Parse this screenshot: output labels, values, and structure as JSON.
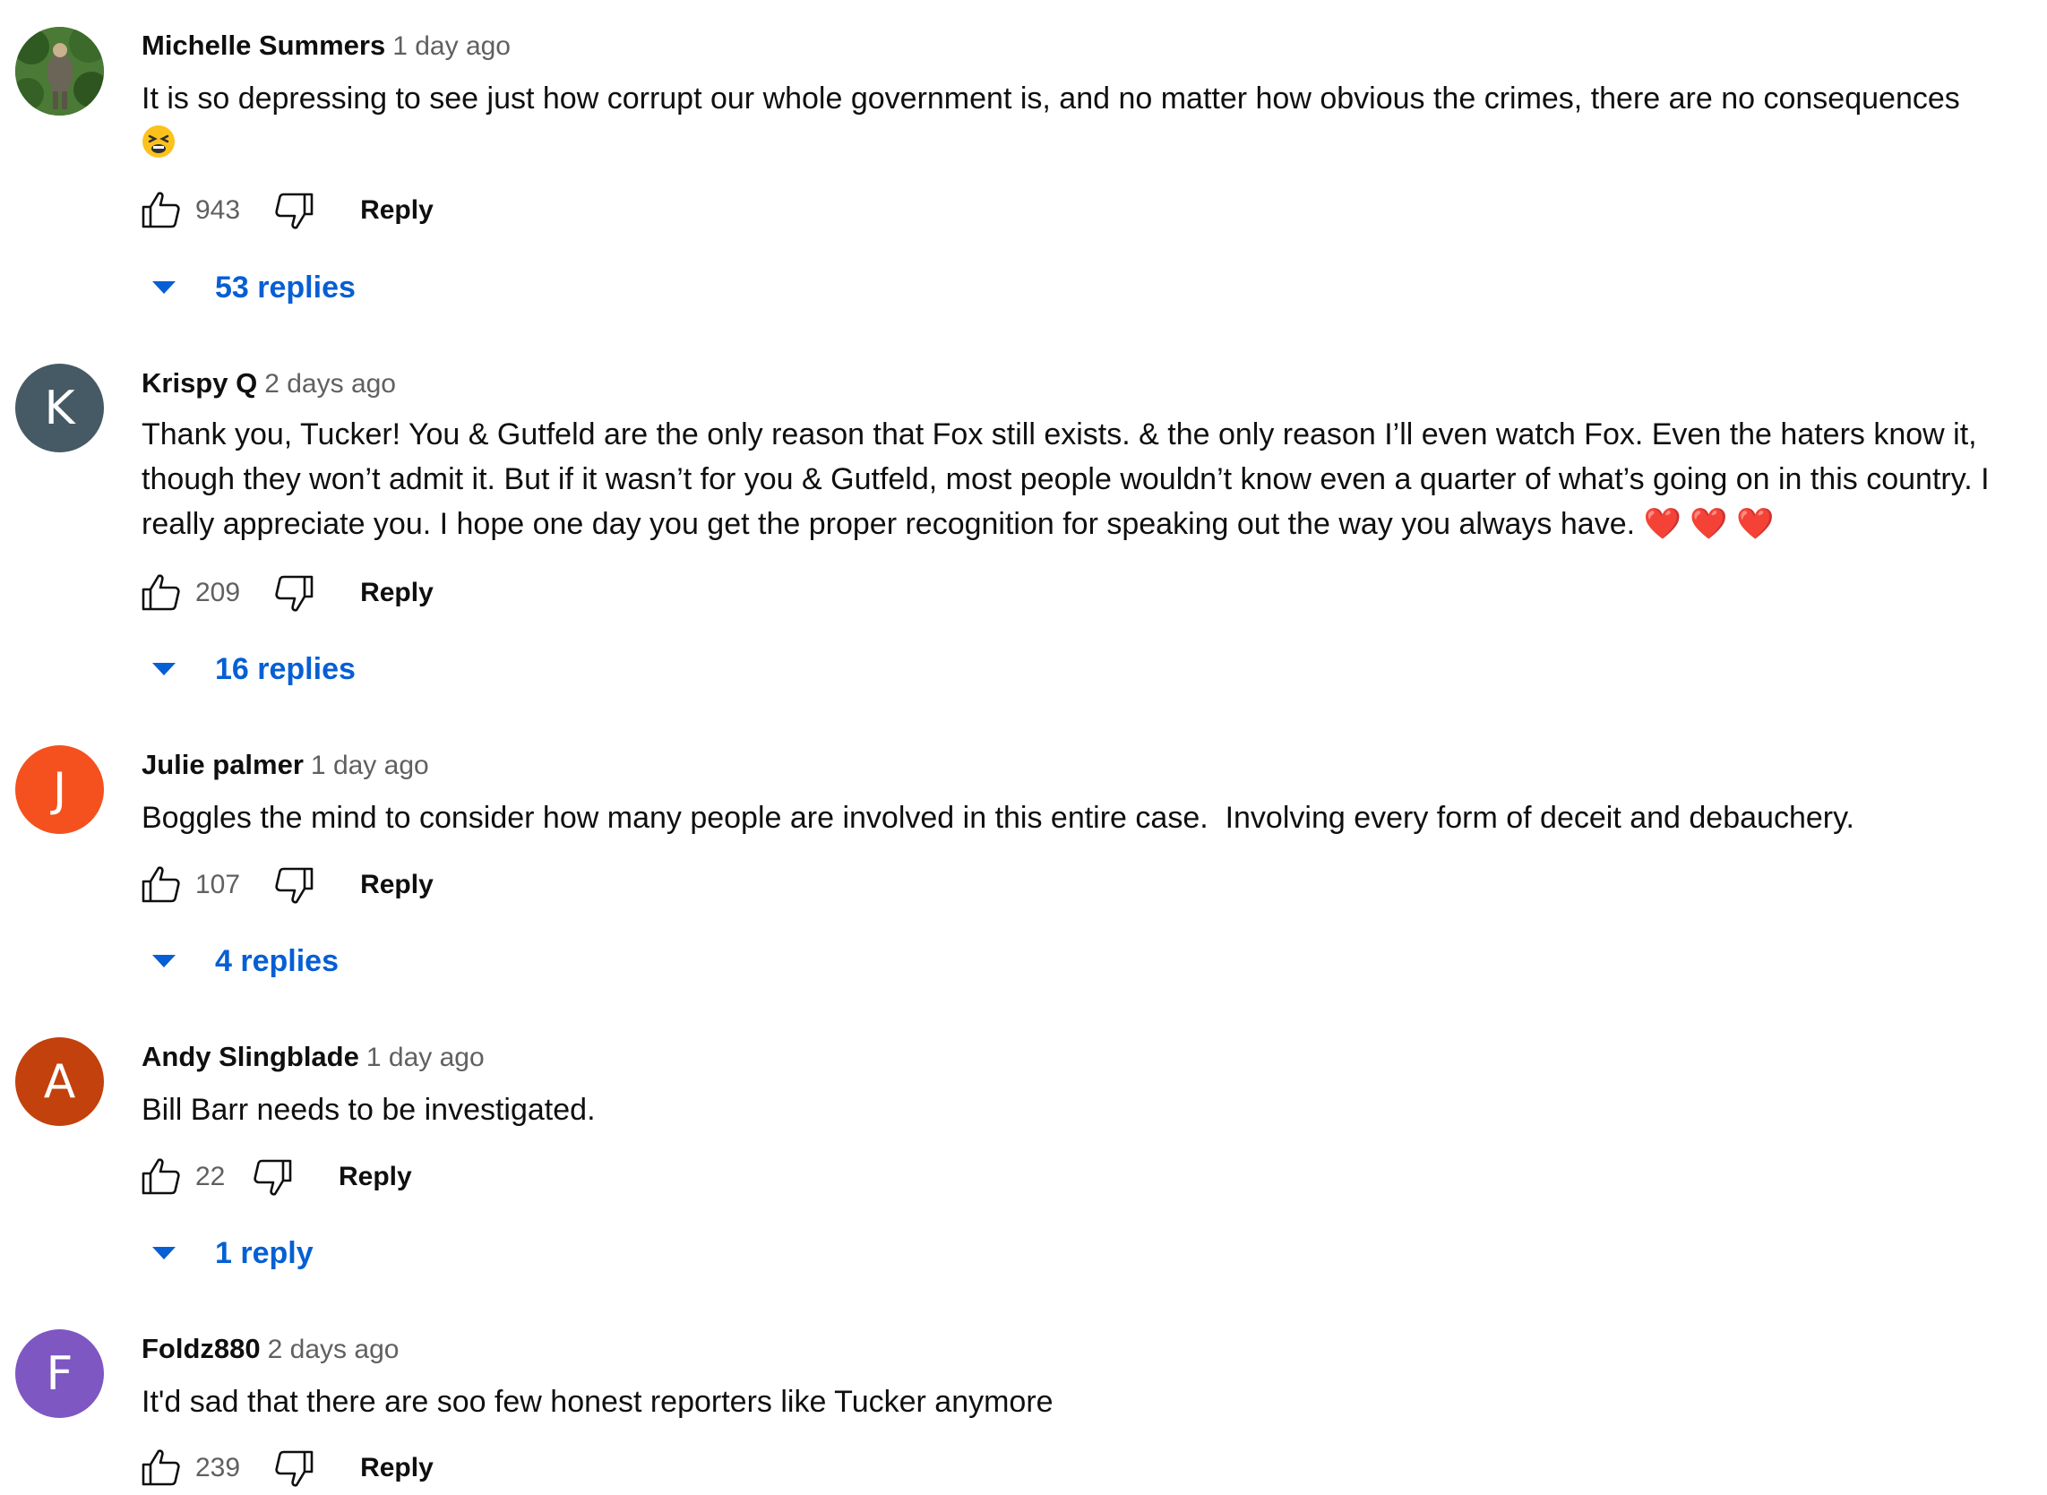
{
  "reply_label": "Reply",
  "colors": {
    "link_blue": "#065fd4",
    "meta_gray": "#606060"
  },
  "comments": [
    {
      "author": "Michelle Summers",
      "time": "1 day ago",
      "avatar": {
        "type": "photo"
      },
      "text": "It is so depressing to see just how corrupt our whole government is, and no matter how obvious the crimes, there are no consequences",
      "trailing_emoji": "tired-face-emoji",
      "likes": "943",
      "replies_label": "53 replies"
    },
    {
      "author": "Krispy Q",
      "time": "2 days ago",
      "avatar": {
        "type": "letter",
        "letter": "K",
        "color": "#455a64"
      },
      "text": "Thank you, Tucker! You & Gutfeld are the only reason that Fox still exists. & the only reason I’ll even watch Fox. Even the haters know it, though they won’t admit it. But if it wasn’t for you & Gutfeld, most people wouldn’t know even a quarter of what’s going on in this country. I really appreciate you. I hope one day you get the proper recognition for speaking out the way you always have. ❤️ ❤️ ❤️",
      "likes": "209",
      "replies_label": "16 replies"
    },
    {
      "author": "Julie palmer",
      "time": "1 day ago",
      "avatar": {
        "type": "letter",
        "letter": "J",
        "color": "#f4511e"
      },
      "text": "Boggles the mind to consider how many people are involved in this entire case.  Involving every form of deceit and debauchery.",
      "likes": "107",
      "replies_label": "4 replies"
    },
    {
      "author": "Andy Slingblade",
      "time": "1 day ago",
      "avatar": {
        "type": "letter",
        "letter": "A",
        "color": "#c2410c"
      },
      "text": "Bill Barr needs to be investigated.",
      "likes": "22",
      "replies_label": "1 reply"
    },
    {
      "author": "Foldz880",
      "time": "2 days ago",
      "avatar": {
        "type": "letter",
        "letter": "F",
        "color": "#7e57c2"
      },
      "text": "It'd sad that there are soo few honest reporters like Tucker anymore",
      "likes": "239"
    }
  ]
}
